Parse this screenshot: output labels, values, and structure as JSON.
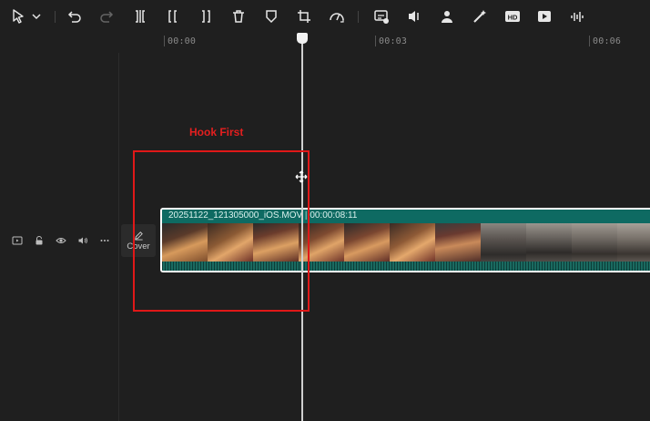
{
  "toolbar": {
    "icons": [
      "select-arrow-icon",
      "chevron-down-icon",
      "undo-icon",
      "redo-icon",
      "split-icon",
      "split-left-icon",
      "split-right-icon",
      "delete-icon",
      "mask-icon",
      "crop-icon",
      "speed-icon",
      "caption-icon",
      "audio-icon",
      "person-icon",
      "magic-icon",
      "hd-icon",
      "play-icon",
      "voice-icon"
    ],
    "hd_label": "HD"
  },
  "ruler": {
    "ticks": [
      "00:00",
      "00:03",
      "00:06"
    ]
  },
  "track_header": {
    "cover_label": "Cover"
  },
  "clip": {
    "filename": "20251122_121305000_iOS.MOV",
    "duration": "00:00:08:11",
    "accent": "#0e6a62"
  },
  "annotation": {
    "label": "Hook First",
    "color": "#e01818"
  }
}
